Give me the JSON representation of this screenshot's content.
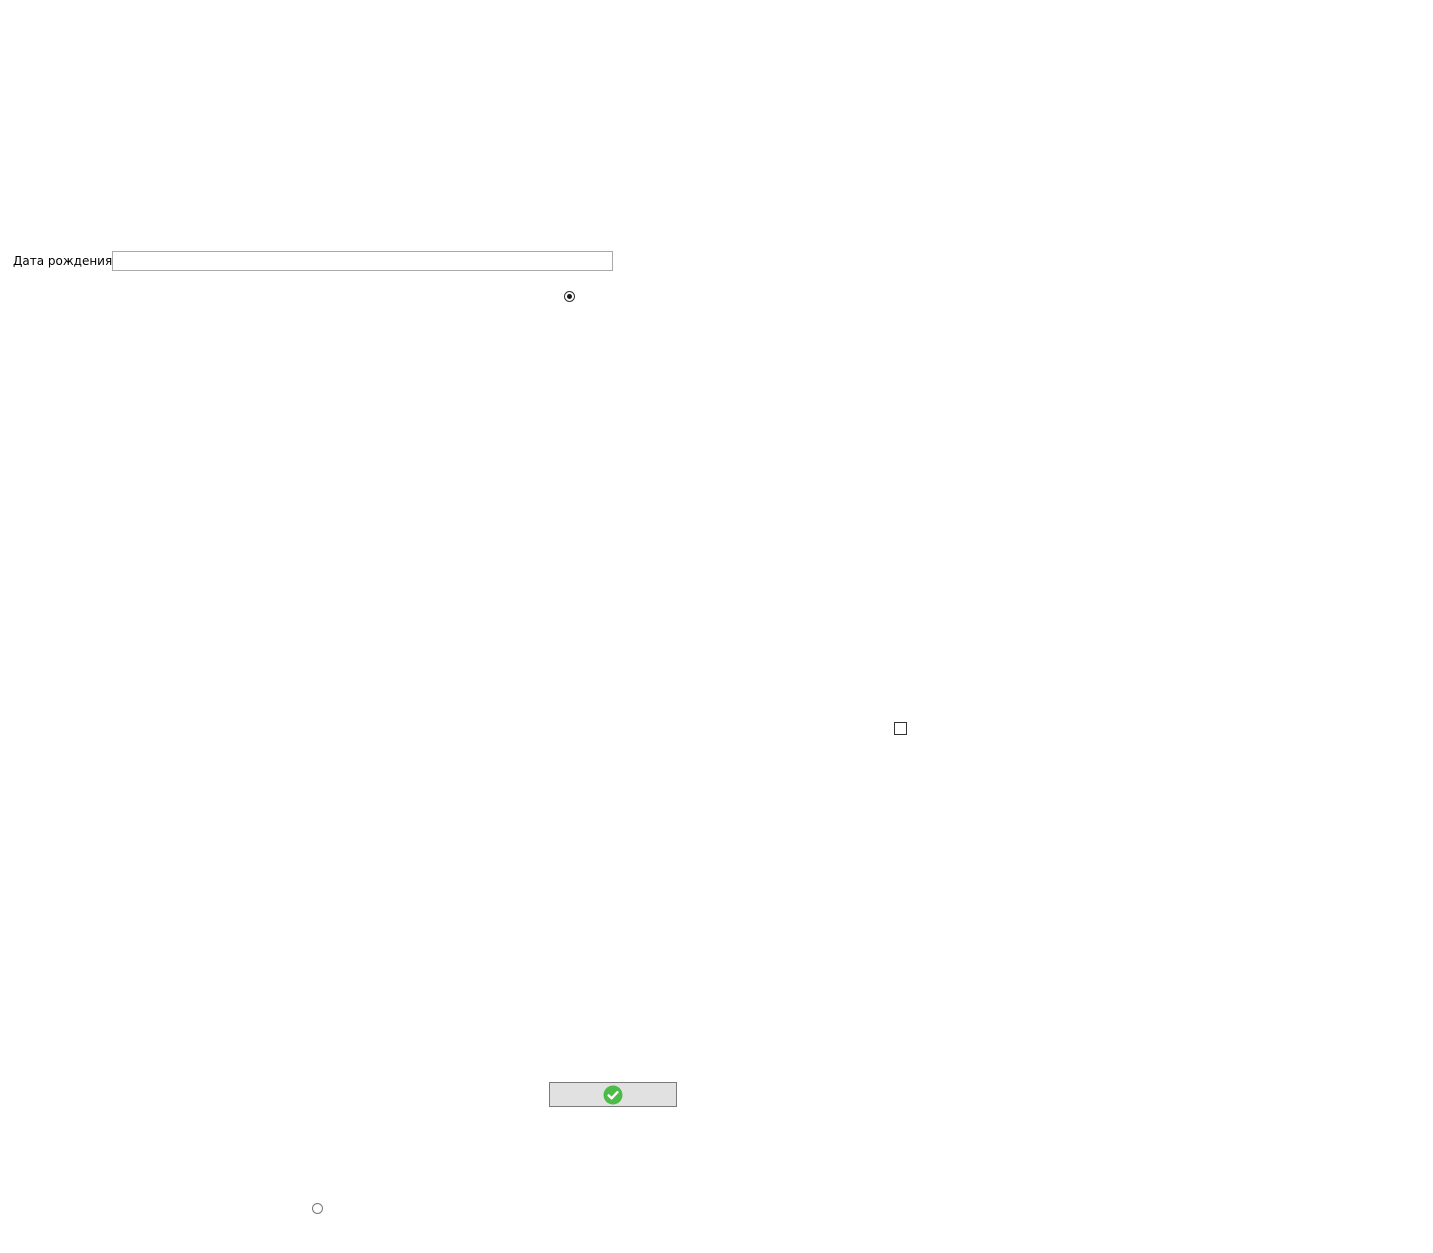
{
  "form": {
    "birth_date_label": "Дата рождения",
    "birth_date_value": "",
    "radio_top": {
      "checked": true
    },
    "checkbox": {
      "checked": false
    },
    "radio_bottom": {
      "checked": false
    }
  },
  "submit_button": {
    "icon": "check-circle-icon",
    "icon_color": "#4cbb47",
    "background": "#e1e1e1"
  }
}
